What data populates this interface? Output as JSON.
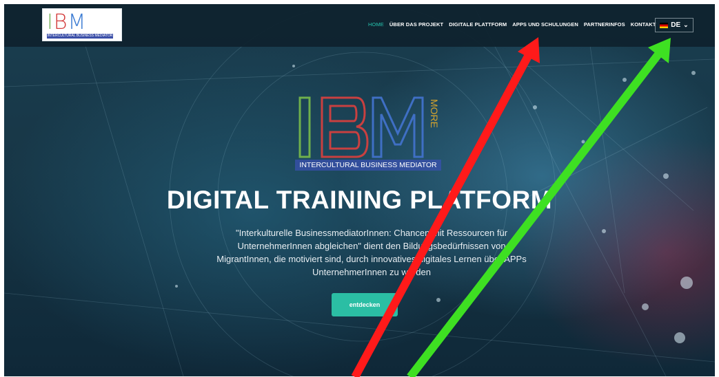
{
  "nav": {
    "logo": {
      "letters": "IBM",
      "more": "MORE",
      "subtitle": "INTERCULTURAL BUSINESS MEDIATOR"
    },
    "items": [
      {
        "label": "HOME",
        "active": true
      },
      {
        "label": "ÜBER DAS PROJEKT"
      },
      {
        "label": "DIGITALE PLATTFORM"
      },
      {
        "label": "APPS UND SCHULUNGEN"
      },
      {
        "label": "PARTNERINFOS"
      },
      {
        "label": "KONTAKT"
      }
    ],
    "language": "DE"
  },
  "hero": {
    "logo_letters": "IBM",
    "logo_more": "MORE",
    "logo_subtitle": "INTERCULTURAL BUSINESS MEDIATOR",
    "headline": "DIGITAL TRAINING PLATFORM",
    "description": "\"Interkulturelle BusinessmediatorInnen: Chancen mit Ressourcen für UnternehmerInnen abgleichen\" dient den Bildungsbedürfnissen von MigrantInnen, die motiviert sind, durch innovatives digitales Lernen über APPs UnternehmerInnen zu werden",
    "cta_label": "entdecken"
  },
  "colors": {
    "accent": "#2bbea4",
    "nav_active": "#26c6b0",
    "annotation_red": "#ff1a1a",
    "annotation_green": "#3ee022"
  },
  "icons": [
    "germany-flag-icon",
    "chevron-down-icon"
  ]
}
